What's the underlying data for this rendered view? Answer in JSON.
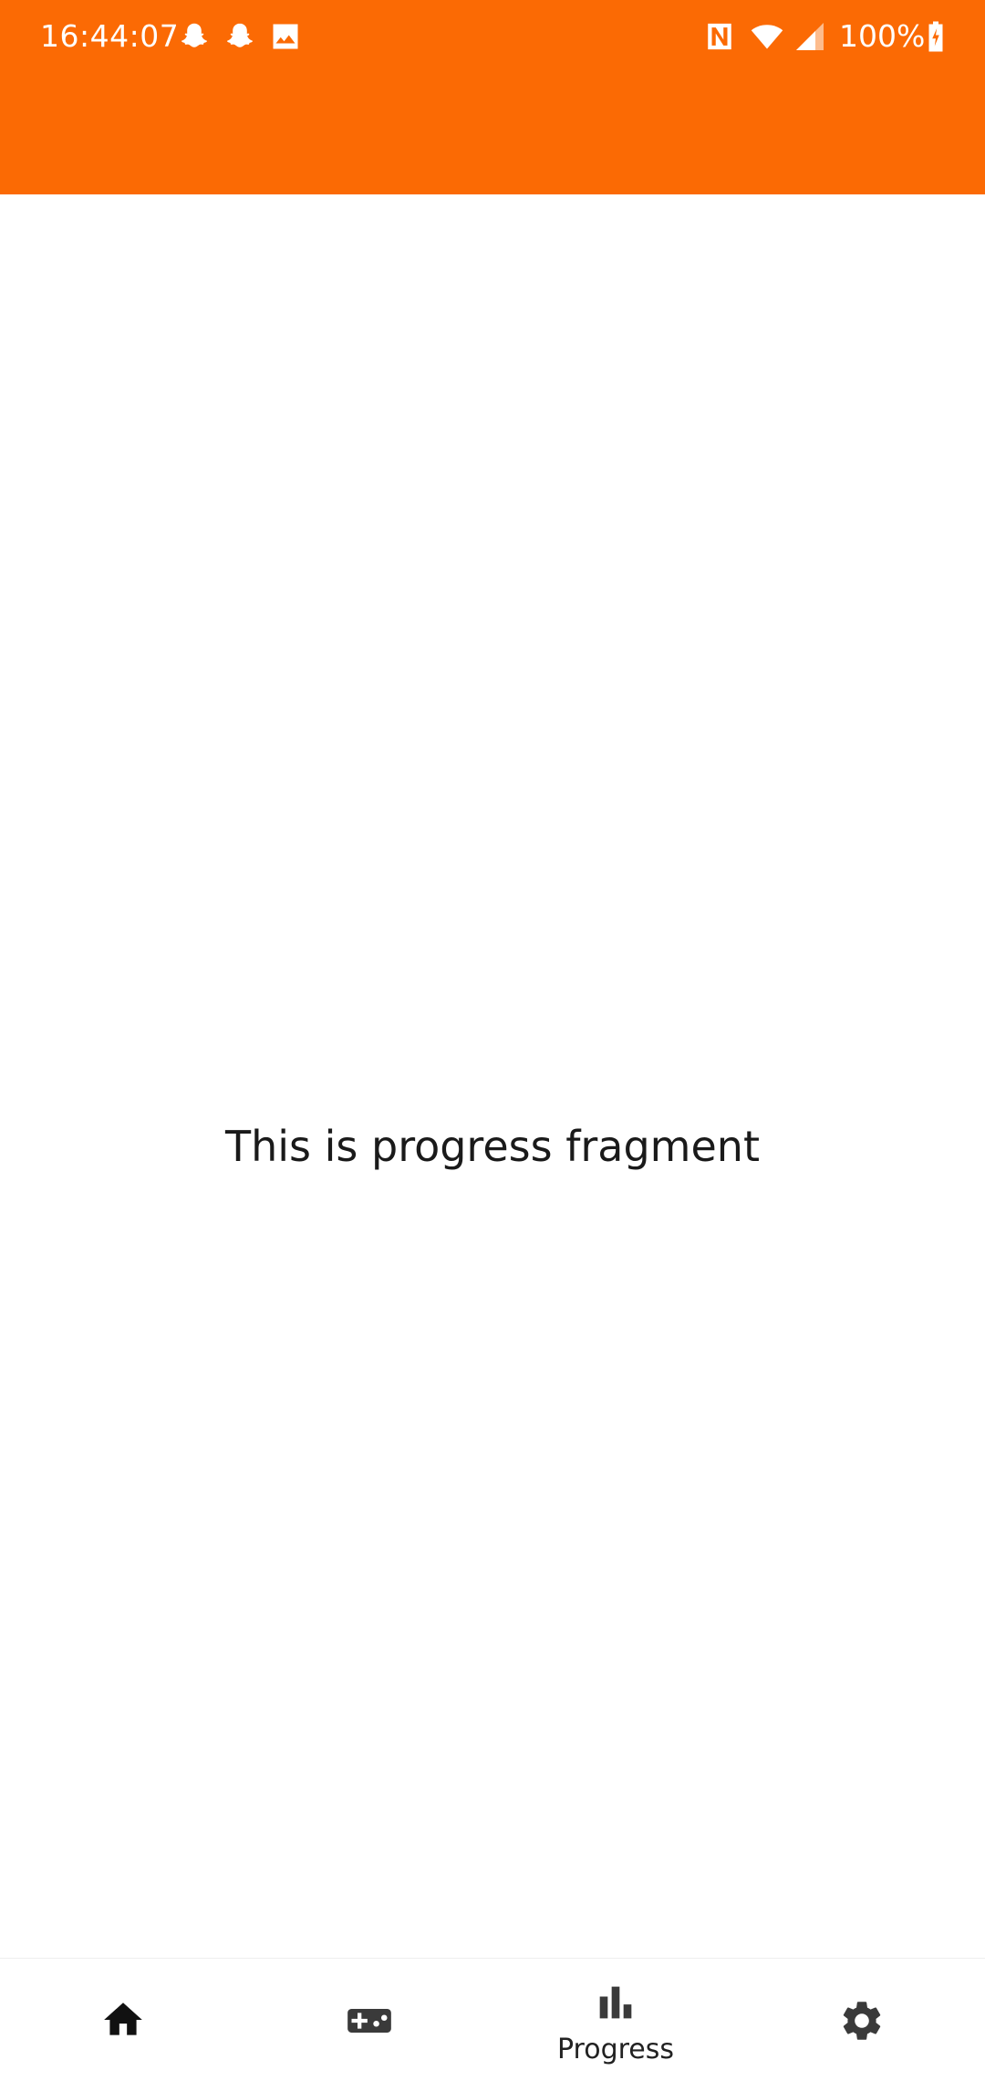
{
  "status_bar": {
    "time": "16:44:07",
    "battery": "100%",
    "notification_icons": [
      "snapchat-icon",
      "snapchat-icon",
      "image-icon"
    ],
    "system_icons": [
      "nfc-icon",
      "wifi-icon",
      "signal-icon",
      "battery-charging-icon"
    ]
  },
  "app_bar": {
    "color": "#FB6A04"
  },
  "content": {
    "message": "This is progress fragment"
  },
  "bottom_nav": {
    "items": [
      {
        "icon": "home-icon",
        "label": ""
      },
      {
        "icon": "gamepad-icon",
        "label": ""
      },
      {
        "icon": "bar-chart-icon",
        "label": "Progress",
        "selected": true
      },
      {
        "icon": "gear-icon",
        "label": ""
      }
    ]
  }
}
